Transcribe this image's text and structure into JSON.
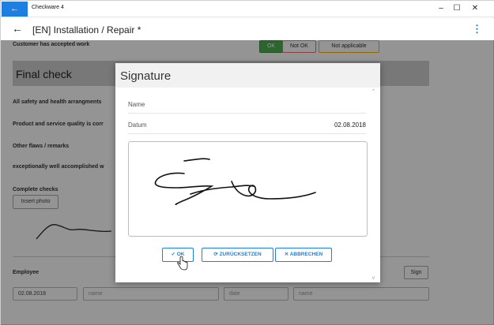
{
  "window": {
    "title": "Checkware 4",
    "back_glyph": "←",
    "minimize_glyph": "–",
    "maximize_glyph": "☐",
    "close_glyph": "✕"
  },
  "appbar": {
    "back_glyph": "←",
    "title": "[EN] Installation / Repair *",
    "more_glyph": "⋮"
  },
  "form": {
    "cut_label": "Customer has accepted work",
    "status_buttons": {
      "ok": "OK",
      "not_ok": "Not OK",
      "not_applicable": "Not applicable"
    },
    "section_title": "Final check",
    "rows": [
      "All safety and health arrangments",
      "Product and service quality is corr",
      "Other flaws / remarks",
      "exceptionally well accomplished w",
      "Complete checks"
    ],
    "insert_photo": "Insert photo",
    "employee_label": "Employee",
    "sign_button": "Sign",
    "fields": {
      "date_value": "02.08.2018",
      "name_placeholder": "name",
      "date_placeholder": "date",
      "name2_placeholder": "name"
    }
  },
  "dialog": {
    "title": "Signature",
    "name_label": "Name",
    "name_value": "",
    "date_label": "Datum",
    "date_value": "02.08.2018",
    "buttons": {
      "ok": "✓ OK",
      "reset": "⟳ ZURÜCKSETZEN",
      "cancel": "✕ ABBRECHEN"
    },
    "scroll_up": "^",
    "scroll_down": "v"
  },
  "colors": {
    "accent": "#1e7fe0",
    "ok_green": "#4caf50",
    "not_ok_red": "#e57373",
    "na_yellow": "#f0b400"
  },
  "icons": [
    "back-arrow-icon",
    "more-vert-icon",
    "check-icon",
    "reset-icon",
    "close-icon",
    "hand-cursor-icon"
  ]
}
